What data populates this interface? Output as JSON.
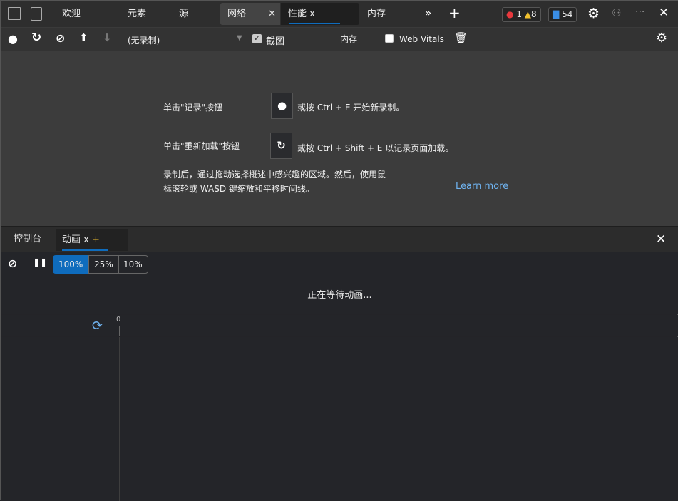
{
  "top_tabs": {
    "welcome": "欢迎",
    "elements": "元素",
    "sources": "源",
    "network": "网络",
    "performance": "性能 x",
    "memory": "内存"
  },
  "badges": {
    "errors": "1",
    "warnings": "8",
    "messages": "54"
  },
  "perf_toolbar": {
    "recording_select": "(无录制)",
    "screenshots_label": "截图",
    "memory_label": "内存",
    "web_vitals_label": "Web Vitals",
    "screenshots_checked": true,
    "web_vitals_checked": false
  },
  "main": {
    "record_prefix": "单击\"记录\"按钮",
    "record_suffix": "或按 Ctrl + E 开始新录制。",
    "reload_prefix": "单击\"重新加载\"按钮",
    "reload_suffix": "或按 Ctrl + Shift + E 以记录页面加载。",
    "hint_line1": "录制后，通过拖动选择概述中感兴趣的区域。然后，使用鼠",
    "hint_line2": "标滚轮或 WASD 键缩放和平移时间线。",
    "learn_more": "Learn more"
  },
  "drawer": {
    "console_tab": "控制台",
    "animations_tab": "动画 x",
    "add_tab": "+"
  },
  "animations": {
    "speeds": [
      "100%",
      "25%",
      "10%"
    ],
    "selected_speed": "100%",
    "waiting": "正在等待动画...",
    "timeline_zero": "0"
  },
  "colors": {
    "accent": "#0f6cbd",
    "link": "#6fb3f0",
    "error": "#e8383d",
    "warning": "#f2c12e",
    "message": "#3a8ee6"
  }
}
